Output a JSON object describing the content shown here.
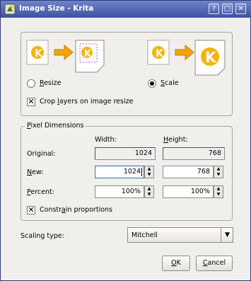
{
  "window": {
    "title": "Image Size - Krita",
    "title_buttons": [
      "?",
      "□",
      "✕"
    ]
  },
  "mode": {
    "resize_label_pre": "",
    "resize_label_key": "R",
    "resize_label_post": "esize",
    "scale_label_pre": "",
    "scale_label_key": "S",
    "scale_label_post": "cale",
    "selected": "Scale",
    "crop_label_pre": "Crop ",
    "crop_label_key": "l",
    "crop_label_post": "ayers on image resize",
    "crop_checked": true
  },
  "pixel_dimensions": {
    "legend_pre": "",
    "legend_key": "P",
    "legend_post": "ixel Dimensions",
    "width_header": "Width:",
    "height_header_pre": "",
    "height_header_key": "H",
    "height_header_post": "eight:",
    "original_label": "Original:",
    "original_width": "1024",
    "original_height": "768",
    "new_label_pre": "",
    "new_label_key": "N",
    "new_label_post": "ew:",
    "new_width": "1024",
    "new_height": "768",
    "percent_label_pre": "",
    "percent_label_key": "P",
    "percent_label_post": "ercent:",
    "percent_width": "100%",
    "percent_height": "100%",
    "constrain_label_pre": "Constr",
    "constrain_label_key": "a",
    "constrain_label_post": "in proportions",
    "constrain_checked": true
  },
  "scaling": {
    "label": "Scaling type:",
    "selected": "Mitchell"
  },
  "buttons": {
    "ok_key": "O",
    "ok_post": "K",
    "cancel_key": "C",
    "cancel_post": "ancel"
  },
  "colors": {
    "titlebar": "#4b5fae",
    "window_bg": "#f0efeb",
    "arrow": "#f2a400"
  },
  "icons": {
    "app": "krita-icon",
    "resize_before": "krita-document-icon",
    "resize_arrow": "arrow-right-icon",
    "resize_after": "cropped-document-icon",
    "scale_before": "krita-document-icon",
    "scale_arrow": "arrow-right-icon",
    "scale_after": "scaled-document-icon"
  }
}
